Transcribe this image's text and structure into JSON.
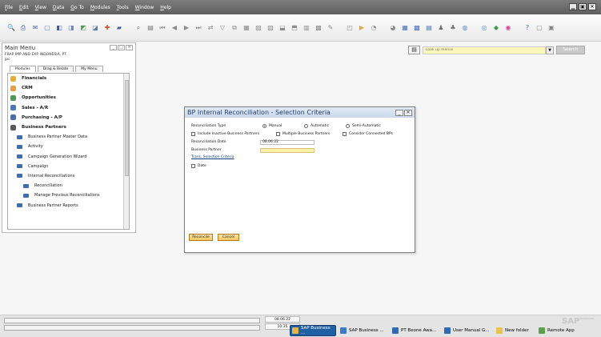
{
  "menubar": {
    "items": [
      "File",
      "Edit",
      "View",
      "Data",
      "Go To",
      "Modules",
      "Tools",
      "Window",
      "Help"
    ],
    "controls": [
      "▁",
      "▣",
      "✕"
    ]
  },
  "toolbar": {
    "icons": [
      {
        "name": "preview-icon",
        "glyph": "🔍",
        "color": "#4b73b8"
      },
      {
        "name": "print-icon",
        "glyph": "⎙",
        "color": "#3a5fa0"
      },
      {
        "name": "email-icon",
        "glyph": "✉",
        "color": "#3c66a8"
      },
      {
        "name": "sms-icon",
        "glyph": "▢",
        "color": "#5a7fbf"
      },
      {
        "name": "fax-icon",
        "glyph": "◧",
        "color": "#3a5fa0"
      },
      {
        "name": "export-word-icon",
        "glyph": "◨",
        "color": "#6a88c4"
      },
      {
        "name": "export-excel-icon",
        "glyph": "◩",
        "color": "#4f9a57"
      },
      {
        "name": "export-pdf-icon",
        "glyph": "◪",
        "color": "#5e79b0"
      },
      {
        "name": "launch-app-icon",
        "glyph": "✚",
        "color": "#d04b2a"
      },
      {
        "name": "lock-screen-icon",
        "glyph": "▰",
        "color": "#3a5fa0"
      },
      {
        "name": "find-icon",
        "glyph": "⌕",
        "color": "#6f6f6f"
      },
      {
        "name": "add-icon",
        "glyph": "▤",
        "color": "#777"
      },
      {
        "name": "first-record-icon",
        "glyph": "⏮",
        "color": "#8c8c8c"
      },
      {
        "name": "previous-record-icon",
        "glyph": "◀",
        "color": "#8c8c8c"
      },
      {
        "name": "next-record-icon",
        "glyph": "▶",
        "color": "#8c8c8c"
      },
      {
        "name": "last-record-icon",
        "glyph": "⏭",
        "color": "#8c8c8c"
      },
      {
        "name": "refresh-icon",
        "glyph": "⇄",
        "color": "#8c8c8c"
      },
      {
        "name": "filter-icon",
        "glyph": "▽",
        "color": "#8c8c8c"
      },
      {
        "name": "sort-icon",
        "glyph": "⧉",
        "color": "#8c8c8c"
      },
      {
        "name": "base-document-icon",
        "glyph": "▦",
        "color": "#8c8c8c"
      },
      {
        "name": "target-document-icon",
        "glyph": "▧",
        "color": "#8c8c8c"
      },
      {
        "name": "drilldown-icon",
        "glyph": "▨",
        "color": "#8c8c8c"
      },
      {
        "name": "gross-profit-icon",
        "glyph": "⬓",
        "color": "#8c8c8c"
      },
      {
        "name": "cash-flow-icon",
        "glyph": "⬒",
        "color": "#8c8c8c"
      },
      {
        "name": "settings-icon",
        "glyph": "▥",
        "color": "#8c8c8c"
      },
      {
        "name": "form-settings-icon",
        "glyph": "▩",
        "color": "#8c8c8c"
      },
      {
        "name": "edit-icon",
        "glyph": "✎",
        "color": "#8c8c8c"
      },
      {
        "name": "layout-icon",
        "glyph": "◰",
        "color": "#8c8c8c"
      },
      {
        "name": "journal-icon",
        "glyph": "▶",
        "color": "#e6a73c"
      },
      {
        "name": "alerts-icon",
        "glyph": "◔",
        "color": "#8c8c8c"
      },
      {
        "name": "messages-icon",
        "glyph": "◕",
        "color": "#8c8c8c"
      },
      {
        "name": "calendar-icon",
        "glyph": "▦",
        "color": "#4a72b8"
      },
      {
        "name": "dashboard-icon",
        "glyph": "▩",
        "color": "#4a72b8"
      },
      {
        "name": "reports-icon",
        "glyph": "▤",
        "color": "#4a72b8"
      },
      {
        "name": "users-icon",
        "glyph": "♟",
        "color": "#6f6f6f"
      },
      {
        "name": "network-icon",
        "glyph": "♣",
        "color": "#6f6f6f"
      },
      {
        "name": "copy-icon",
        "glyph": "◍",
        "color": "#5a8dc9"
      },
      {
        "name": "paste-icon",
        "glyph": "◎",
        "color": "#5a8dc9"
      },
      {
        "name": "cockpit-icon",
        "glyph": "◆",
        "color": "#3f9d4a"
      },
      {
        "name": "widget-icon",
        "glyph": "◉",
        "color": "#d9459b"
      },
      {
        "name": "help-icon",
        "glyph": "?",
        "color": "#3a6fb7"
      },
      {
        "name": "minimize-all-icon",
        "glyph": "▢",
        "color": "#888"
      },
      {
        "name": "close-all-icon",
        "glyph": "▣",
        "color": "#888"
      }
    ]
  },
  "main_menu": {
    "title": "Main Menu",
    "company_line1": "FRAP IMP AND EXP INDONESIA, PT",
    "company_line2": "jpc",
    "tabs": [
      "Modules",
      "Drag & Relate",
      "My Menu"
    ],
    "items": [
      {
        "label": "Financials",
        "level": 0,
        "icon_color": "#e8b030"
      },
      {
        "label": "CRM",
        "level": 0,
        "icon_color": "#e9a03a"
      },
      {
        "label": "Opportunities",
        "level": 0,
        "icon_color": "#4e9a57"
      },
      {
        "label": "Sales - A/R",
        "level": 0,
        "icon_color": "#4a78b8"
      },
      {
        "label": "Purchasing - A/P",
        "level": 0,
        "icon_color": "#4a6fa8"
      },
      {
        "label": "Business Partners",
        "level": 0,
        "icon_color": "#5a5a5a"
      },
      {
        "label": "Business Partner Master Data",
        "level": 1
      },
      {
        "label": "Activity",
        "level": 1
      },
      {
        "label": "Campaign Generation Wizard",
        "level": 1
      },
      {
        "label": "Campaign",
        "level": 1
      },
      {
        "label": "Internal Reconciliations",
        "level": 1
      },
      {
        "label": "Reconciliation",
        "level": 2
      },
      {
        "label": "Manage Previous Reconciliations",
        "level": 2
      },
      {
        "label": "Business Partner Reports",
        "level": 1
      }
    ]
  },
  "findbar": {
    "placeholder": "Look up menus",
    "search_label": "Search"
  },
  "dialog": {
    "title": "BP Internal Reconciliation - Selection Criteria",
    "reconciliation_type_label": "Reconciliation Type",
    "radio_manual": "Manual",
    "radio_automatic": "Automatic",
    "radio_semi": "Semi-Automatic",
    "include_inactive": "Include Inactive Business Partners",
    "multiple_bp": "Multiple Business Partners",
    "connected_bps": "Consider Connected BPs",
    "reconciliation_date_label": "Reconciliation Date",
    "reconciliation_date_value": "08.06.22",
    "business_partner_label": "Business Partner",
    "business_partner_value": "",
    "trans_selection_criteria": "Trans. Selection Criteria",
    "date_label": "Date",
    "reconcile_button": "Reconcile",
    "cancel_button": "Cancel"
  },
  "statusbar": {
    "date": "08.06.22",
    "time": "10:35",
    "logo": "SAP",
    "logo_suffix": "Business"
  },
  "taskbar": [
    {
      "label": "SAP Business ...",
      "active": true,
      "icon_color": "#e6b54a"
    },
    {
      "label": "SAP Business ...",
      "active": false,
      "icon_color": "#3a7ac7"
    },
    {
      "label": "PT Beone Awa...",
      "active": false,
      "icon_color": "#2f6ab5"
    },
    {
      "label": "User Manual G...",
      "active": false,
      "icon_color": "#2f6ab5"
    },
    {
      "label": "New folder",
      "active": false,
      "icon_color": "#e8c24a"
    },
    {
      "label": "Remote App",
      "active": false,
      "icon_color": "#58a24a"
    }
  ]
}
